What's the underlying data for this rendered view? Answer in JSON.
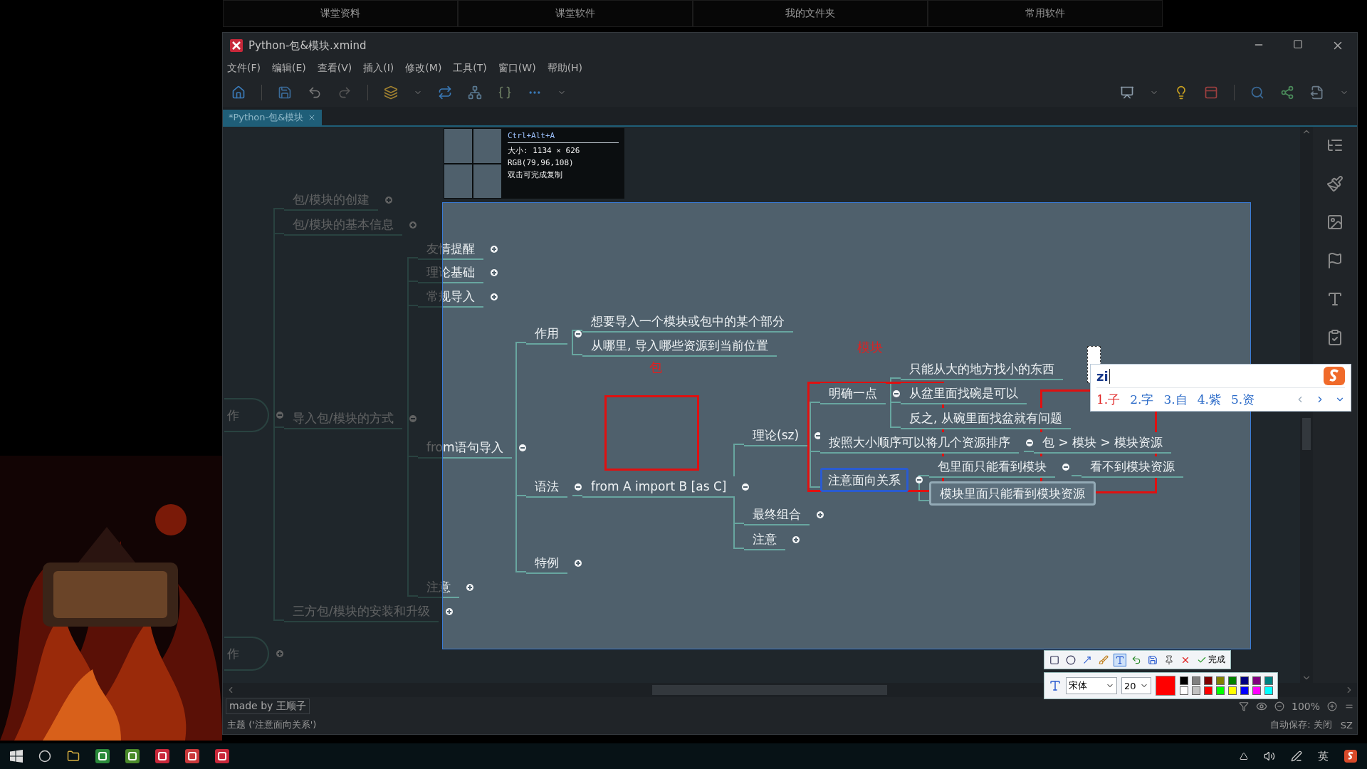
{
  "top_tabs": [
    "课堂资料",
    "课堂软件",
    "我的文件夹",
    "常用软件"
  ],
  "window": {
    "title": "Python-包&模块.xmind"
  },
  "menu": [
    "文件(F)",
    "编辑(E)",
    "查看(V)",
    "插入(I)",
    "修改(M)",
    "工具(T)",
    "窗口(W)",
    "帮助(H)"
  ],
  "document_tab": {
    "label": "*Python-包&模块",
    "selected": true
  },
  "mindmap": {
    "topics": [
      {
        "text": "作",
        "expanded": true,
        "selected": false,
        "highlighted": false,
        "children": [
          {
            "text": "包/模块的创建",
            "expanded": false,
            "selected": false,
            "highlighted": false
          },
          {
            "text": "包/模块的基本信息",
            "expanded": false,
            "selected": false,
            "highlighted": false
          },
          {
            "text": "导入包/模块的方式",
            "expanded": true,
            "selected": false,
            "highlighted": false,
            "children": [
              {
                "text": "友情提醒",
                "expanded": false,
                "selected": false,
                "highlighted": false
              },
              {
                "text": "理论基础",
                "expanded": false,
                "selected": false,
                "highlighted": false
              },
              {
                "text": "常规导入",
                "expanded": false,
                "selected": false,
                "highlighted": false
              },
              {
                "text": "from语句导入",
                "expanded": true,
                "selected": false,
                "highlighted": false,
                "children": [
                  {
                    "text": "作用",
                    "expanded": true,
                    "selected": false,
                    "highlighted": false,
                    "children": [
                      {
                        "text": "想要导入一个模块或包中的某个部分",
                        "selected": false,
                        "highlighted": false
                      },
                      {
                        "text": "从哪里, 导入哪些资源到当前位置",
                        "selected": false,
                        "highlighted": false
                      }
                    ]
                  },
                  {
                    "text": "语法",
                    "expanded": true,
                    "selected": false,
                    "highlighted": false,
                    "children": [
                      {
                        "text": "from A import B [as C]",
                        "expanded": true,
                        "selected": false,
                        "highlighted": false,
                        "children": [
                          {
                            "text": "理论(sz)",
                            "expanded": true,
                            "selected": false,
                            "highlighted": false,
                            "children": [
                              {
                                "text": "明确一点",
                                "expanded": true,
                                "selected": false,
                                "highlighted": false,
                                "children": [
                                  {
                                    "text": "只能从大的地方找小的东西",
                                    "selected": false,
                                    "highlighted": false
                                  },
                                  {
                                    "text": "从盆里面找碗是可以",
                                    "selected": false,
                                    "highlighted": false
                                  },
                                  {
                                    "text": "反之, 从碗里面找盆就有问题",
                                    "selected": false,
                                    "highlighted": false
                                  }
                                ]
                              },
                              {
                                "text": "按照大小顺序可以将几个资源排序",
                                "expanded": true,
                                "selected": false,
                                "highlighted": false,
                                "children": [
                                  {
                                    "text": "包 > 模块 > 模块资源",
                                    "selected": false,
                                    "highlighted": false
                                  }
                                ]
                              },
                              {
                                "text": "注意面向关系",
                                "expanded": true,
                                "selected": true,
                                "highlighted": false,
                                "children": [
                                  {
                                    "text": "包里面只能看到模块",
                                    "expanded": true,
                                    "selected": false,
                                    "highlighted": false,
                                    "children": [
                                      {
                                        "text": "看不到模块资源",
                                        "selected": false,
                                        "highlighted": false
                                      }
                                    ]
                                  },
                                  {
                                    "text": "模块里面只能看到模块资源",
                                    "selected": false,
                                    "highlighted": true
                                  }
                                ]
                              }
                            ]
                          },
                          {
                            "text": "最终组合",
                            "expanded": false,
                            "selected": false,
                            "highlighted": false
                          },
                          {
                            "text": "注意",
                            "expanded": false,
                            "selected": false,
                            "highlighted": false
                          }
                        ]
                      }
                    ]
                  },
                  {
                    "text": "特例",
                    "expanded": false,
                    "selected": false,
                    "highlighted": false
                  }
                ]
              },
              {
                "text": "注意",
                "expanded": false,
                "selected": false,
                "highlighted": false
              }
            ]
          },
          {
            "text": "三方包/模块的安装和升级",
            "expanded": false,
            "selected": false,
            "highlighted": false
          }
        ]
      },
      {
        "text": "作",
        "expanded": false,
        "selected": false,
        "highlighted": false
      }
    ]
  },
  "annotations": [
    {
      "kind": "text",
      "text": "模块"
    },
    {
      "kind": "text",
      "text": "包"
    },
    {
      "kind": "rect"
    },
    {
      "kind": "rect"
    },
    {
      "kind": "rect"
    }
  ],
  "magnifier": {
    "shortcut": "Ctrl+Alt+A",
    "size": "大小: 1134 × 626",
    "rgb": "RGB(79,96,108)",
    "hint": "双击可完成复制"
  },
  "ime": {
    "input": "zi",
    "candidates": [
      {
        "text": "1.子",
        "selected": true
      },
      {
        "text": "2.字",
        "selected": false
      },
      {
        "text": "3.自",
        "selected": false
      },
      {
        "text": "4.紫",
        "selected": false
      },
      {
        "text": "5.资",
        "selected": false
      }
    ]
  },
  "screenshot_tools": [
    {
      "kind": "rect",
      "selected": false
    },
    {
      "kind": "ellipse",
      "selected": false
    },
    {
      "kind": "arrow",
      "selected": false
    },
    {
      "kind": "brush",
      "selected": false
    },
    {
      "kind": "text",
      "selected": true
    },
    {
      "kind": "undo",
      "selected": false
    },
    {
      "kind": "save",
      "selected": false
    },
    {
      "kind": "pin",
      "selected": false
    },
    {
      "kind": "cancel",
      "selected": false
    }
  ],
  "done_label": "完成",
  "text_style": {
    "font": "宋体",
    "size": "20",
    "color": "#ff0000"
  },
  "palette": [
    {
      "color": "#000000"
    },
    {
      "color": "#808080"
    },
    {
      "color": "#800000"
    },
    {
      "color": "#808000"
    },
    {
      "color": "#008000"
    },
    {
      "color": "#000080"
    },
    {
      "color": "#800080"
    },
    {
      "color": "#008080"
    },
    {
      "color": "#ffffff"
    },
    {
      "color": "#c0c0c0"
    },
    {
      "color": "#ff0000"
    },
    {
      "color": "#00ff00"
    },
    {
      "color": "#ffff00"
    },
    {
      "color": "#0000ff"
    },
    {
      "color": "#ff00ff"
    },
    {
      "color": "#00ffff"
    }
  ],
  "bottom_bar": {
    "credit": "made by 王顺子",
    "zoom": "100%"
  },
  "status_bar": {
    "topic": "主题 ('注意面向关系')",
    "autosave": "自动保存: 关闭",
    "user": "SZ"
  },
  "taskbar": {
    "input_language": "英"
  }
}
